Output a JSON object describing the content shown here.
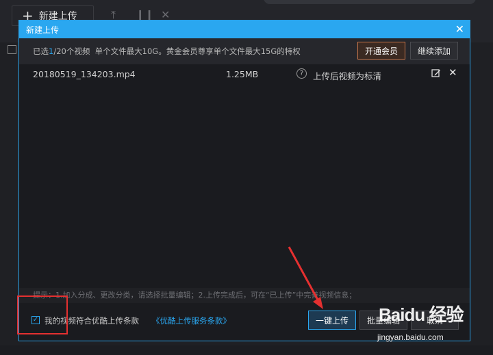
{
  "background": {
    "upload_button": "新建上传",
    "toolbar_icons": [
      "upload-to-top-icon",
      "pause-icon",
      "close-icon"
    ]
  },
  "modal": {
    "title": "新建上传",
    "info": {
      "prefix": "已选",
      "selected": "1",
      "suffix": "/20个视频  单个文件最大10G。黄金会员尊享单个文件最大15G的特权"
    },
    "vip_button": "开通会员",
    "continue_add_button": "继续添加",
    "files": [
      {
        "name": "20180519_134203.mp4",
        "size": "1.25MB",
        "status": "上传后视频为标清"
      }
    ],
    "tip": "提示：1.加入分成、更改分类，请选择批量编辑；2.上传完成后，可在“已上传”中完善视频信息；",
    "agreement_checked": true,
    "agreement_label": "我的视频符合优酷上传条款",
    "terms_link": "《优酷上传服务条款》",
    "oneclick_upload_button": "一键上传",
    "batch_edit_button": "批量编辑",
    "cancel_button": "取消"
  },
  "watermark": {
    "brand": "Baidu 经验",
    "url": "jingyan.baidu.com"
  },
  "colors": {
    "accent": "#2aa7f0",
    "vip_border": "#c9774a",
    "annotation": "#e53030"
  }
}
